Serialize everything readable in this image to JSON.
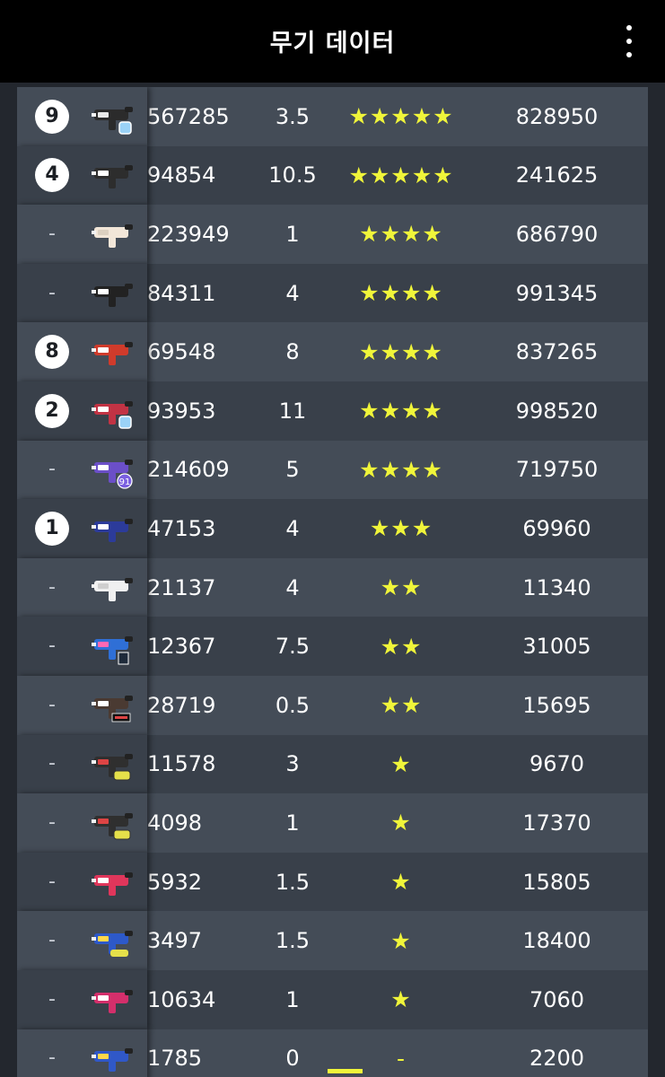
{
  "appbar": {
    "title": "무기 데이터",
    "menu_icon": "more-vertical-icon"
  },
  "colors": {
    "star": "#f0f53a",
    "row_light": "#444c57",
    "row_dark": "#39404a",
    "appbar": "#000000"
  },
  "rows": [
    {
      "rank": "9",
      "badge": "9",
      "partial_value": "567285",
      "value": "3.5",
      "stars": "★★★★★",
      "star_count": 5,
      "total": "828950",
      "icon": "weapon-splat-dualies-icon",
      "sub_badge": "diamond"
    },
    {
      "rank": "4",
      "badge": "4",
      "partial_value": "94854",
      "value": "10.5",
      "stars": "★★★★★",
      "star_count": 5,
      "total": "241625",
      "icon": "weapon-eliter-icon"
    },
    {
      "rank": "-",
      "badge": "",
      "partial_value": "223949",
      "value": "1",
      "stars": "★★★★",
      "star_count": 4,
      "total": "686790",
      "icon": "weapon-blaster-icon"
    },
    {
      "rank": "-",
      "badge": "",
      "partial_value": "84311",
      "value": "4",
      "stars": "★★★★",
      "star_count": 4,
      "total": "991345",
      "icon": "weapon-shooter-icon"
    },
    {
      "rank": "8",
      "badge": "8",
      "partial_value": "69548",
      "value": "8",
      "stars": "★★★★",
      "star_count": 4,
      "total": "837265",
      "icon": "weapon-splattershot-icon"
    },
    {
      "rank": "2",
      "badge": "2",
      "partial_value": "93953",
      "value": "11",
      "stars": "★★★★",
      "star_count": 4,
      "total": "998520",
      "icon": "weapon-squeezer-icon",
      "sub_badge": "diamond"
    },
    {
      "rank": "-",
      "badge": "",
      "partial_value": "214609",
      "value": "5",
      "stars": "★★★★",
      "star_count": 4,
      "total": "719750",
      "icon": "weapon-nzap-icon",
      "sub_badge": "91"
    },
    {
      "rank": "1",
      "badge": "1",
      "partial_value": "47153",
      "value": "4",
      "stars": "★★★",
      "star_count": 3,
      "total": "69960",
      "icon": "weapon-jet-squelcher-icon"
    },
    {
      "rank": "-",
      "badge": "",
      "partial_value": "21137",
      "value": "4",
      "stars": "★★",
      "star_count": 2,
      "total": "11340",
      "icon": "weapon-dualie-white-icon"
    },
    {
      "rank": "-",
      "badge": "",
      "partial_value": "12367",
      "value": "7.5",
      "stars": "★★",
      "star_count": 2,
      "total": "31005",
      "icon": "weapon-squiffer-icon",
      "sub_badge": "x"
    },
    {
      "rank": "-",
      "badge": "",
      "partial_value": "28719",
      "value": "0.5",
      "stars": "★★",
      "star_count": 2,
      "total": "15695",
      "icon": "weapon-kensa-icon",
      "sub_badge": "kensa"
    },
    {
      "rank": "-",
      "badge": "",
      "partial_value": "11578",
      "value": "3",
      "stars": "★",
      "star_count": 1,
      "total": "9670",
      "icon": "weapon-hero-shot-icon",
      "sub_badge": "hero"
    },
    {
      "rank": "-",
      "badge": "",
      "partial_value": "4098",
      "value": "1",
      "stars": "★",
      "star_count": 1,
      "total": "17370",
      "icon": "weapon-hero-dualie-icon",
      "sub_badge": "hero"
    },
    {
      "rank": "-",
      "badge": "",
      "partial_value": "5932",
      "value": "1.5",
      "stars": "★",
      "star_count": 1,
      "total": "15805",
      "icon": "weapon-pink-blaster-icon"
    },
    {
      "rank": "-",
      "badge": "",
      "partial_value": "3497",
      "value": "1.5",
      "stars": "★",
      "star_count": 1,
      "total": "18400",
      "icon": "weapon-blue-blaster-icon",
      "sub_badge": "replica"
    },
    {
      "rank": "-",
      "badge": "",
      "partial_value": "10634",
      "value": "1",
      "stars": "★",
      "star_count": 1,
      "total": "7060",
      "icon": "weapon-pink-shooter-icon"
    },
    {
      "rank": "-",
      "badge": "",
      "partial_value": "1785",
      "value": "0",
      "stars": "-",
      "star_count": 0,
      "total": "2200",
      "icon": "weapon-blue-shooter-icon"
    }
  ]
}
